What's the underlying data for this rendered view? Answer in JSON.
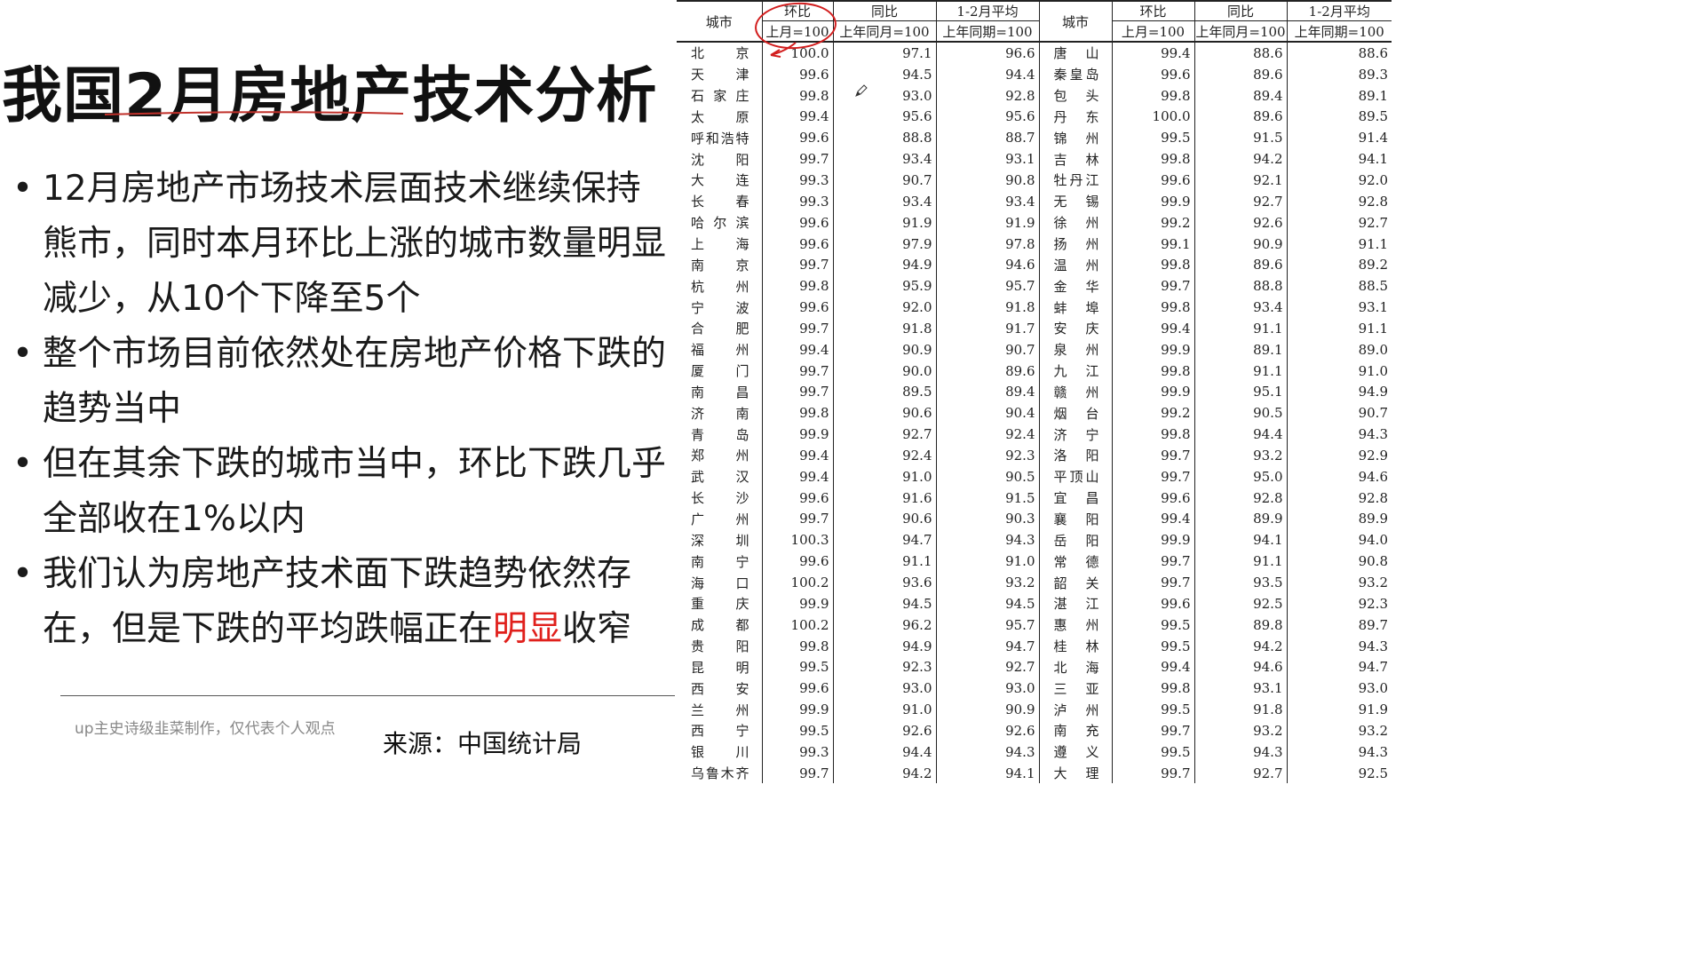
{
  "slide": {
    "title": "我国2月房地产技术分析",
    "bullets": [
      {
        "text": "12月房地产市场技术层面技术继续保持熊市，同时本月环比上涨的城市数量明显减少，从10个下降至5个"
      },
      {
        "text": "整个市场目前依然处在房地产价格下跌的趋势当中"
      },
      {
        "text": "但在其余下跌的城市当中，环比下跌几乎全部收在1%以内"
      },
      {
        "text_before": "我们认为房地产技术面下跌趋势依然存在，但是下跌的平均跌幅正在",
        "highlight": "明显",
        "text_after": "收窄"
      }
    ],
    "bullet_glyph": "•",
    "footer_note": "up主史诗级韭菜制作，仅代表个人观点",
    "source": "来源：中国统计局",
    "colors": {
      "highlight": "#e0201c",
      "annotation": "#d21d1d"
    }
  },
  "table": {
    "headers": {
      "city": "城市",
      "mom": "环比",
      "mom_base": "上月=100",
      "yoy": "同比",
      "yoy_base": "上年同月=100",
      "avg": "1-2月平均",
      "avg_base": "上年同期=100"
    },
    "rows": [
      {
        "left": [
          "北　京",
          "100.0",
          "97.1",
          "96.6"
        ],
        "right": [
          "唐　山",
          "99.4",
          "88.6",
          "88.6"
        ]
      },
      {
        "left": [
          "天　津",
          "99.6",
          "94.5",
          "94.4"
        ],
        "right": [
          "秦皇岛",
          "99.6",
          "89.6",
          "89.3"
        ]
      },
      {
        "left": [
          "石家庄",
          "99.8",
          "93.0",
          "92.8"
        ],
        "right": [
          "包　头",
          "99.8",
          "89.4",
          "89.1"
        ]
      },
      {
        "left": [
          "太　原",
          "99.4",
          "95.6",
          "95.6"
        ],
        "right": [
          "丹　东",
          "100.0",
          "89.6",
          "89.5"
        ]
      },
      {
        "left": [
          "呼和浩特",
          "99.6",
          "88.8",
          "88.7"
        ],
        "right": [
          "锦　州",
          "99.5",
          "91.5",
          "91.4"
        ]
      },
      {
        "left": [
          "沈　阳",
          "99.7",
          "93.4",
          "93.1"
        ],
        "right": [
          "吉　林",
          "99.8",
          "94.2",
          "94.1"
        ]
      },
      {
        "left": [
          "大　连",
          "99.3",
          "90.7",
          "90.8"
        ],
        "right": [
          "牡丹江",
          "99.6",
          "92.1",
          "92.0"
        ]
      },
      {
        "left": [
          "长　春",
          "99.3",
          "93.4",
          "93.4"
        ],
        "right": [
          "无　锡",
          "99.9",
          "92.7",
          "92.8"
        ]
      },
      {
        "left": [
          "哈尔滨",
          "99.6",
          "91.9",
          "91.9"
        ],
        "right": [
          "徐　州",
          "99.2",
          "92.6",
          "92.7"
        ]
      },
      {
        "left": [
          "上　海",
          "99.6",
          "97.9",
          "97.8"
        ],
        "right": [
          "扬　州",
          "99.1",
          "90.9",
          "91.1"
        ]
      },
      {
        "left": [
          "南　京",
          "99.7",
          "94.9",
          "94.6"
        ],
        "right": [
          "温　州",
          "99.8",
          "89.6",
          "89.2"
        ]
      },
      {
        "left": [
          "杭　州",
          "99.8",
          "95.9",
          "95.7"
        ],
        "right": [
          "金　华",
          "99.7",
          "88.8",
          "88.5"
        ]
      },
      {
        "left": [
          "宁　波",
          "99.6",
          "92.0",
          "91.8"
        ],
        "right": [
          "蚌　埠",
          "99.8",
          "93.4",
          "93.1"
        ]
      },
      {
        "left": [
          "合　肥",
          "99.7",
          "91.8",
          "91.7"
        ],
        "right": [
          "安　庆",
          "99.4",
          "91.1",
          "91.1"
        ]
      },
      {
        "left": [
          "福　州",
          "99.4",
          "90.9",
          "90.7"
        ],
        "right": [
          "泉　州",
          "99.9",
          "89.1",
          "89.0"
        ]
      },
      {
        "left": [
          "厦　门",
          "99.7",
          "90.0",
          "89.6"
        ],
        "right": [
          "九　江",
          "99.8",
          "91.1",
          "91.0"
        ]
      },
      {
        "left": [
          "南　昌",
          "99.7",
          "89.5",
          "89.4"
        ],
        "right": [
          "赣　州",
          "99.9",
          "95.1",
          "94.9"
        ]
      },
      {
        "left": [
          "济　南",
          "99.8",
          "90.6",
          "90.4"
        ],
        "right": [
          "烟　台",
          "99.2",
          "90.5",
          "90.7"
        ]
      },
      {
        "left": [
          "青　岛",
          "99.9",
          "92.7",
          "92.4"
        ],
        "right": [
          "济　宁",
          "99.8",
          "94.4",
          "94.3"
        ]
      },
      {
        "left": [
          "郑　州",
          "99.4",
          "92.4",
          "92.3"
        ],
        "right": [
          "洛　阳",
          "99.7",
          "93.2",
          "92.9"
        ]
      },
      {
        "left": [
          "武　汉",
          "99.4",
          "91.0",
          "90.5"
        ],
        "right": [
          "平顶山",
          "99.7",
          "95.0",
          "94.6"
        ]
      },
      {
        "left": [
          "长　沙",
          "99.6",
          "91.6",
          "91.5"
        ],
        "right": [
          "宜　昌",
          "99.6",
          "92.8",
          "92.8"
        ]
      },
      {
        "left": [
          "广　州",
          "99.7",
          "90.6",
          "90.3"
        ],
        "right": [
          "襄　阳",
          "99.4",
          "89.9",
          "89.9"
        ]
      },
      {
        "left": [
          "深　圳",
          "100.3",
          "94.7",
          "94.3"
        ],
        "right": [
          "岳　阳",
          "99.9",
          "94.1",
          "94.0"
        ]
      },
      {
        "left": [
          "南　宁",
          "99.6",
          "91.1",
          "91.0"
        ],
        "right": [
          "常　德",
          "99.7",
          "91.1",
          "90.8"
        ]
      },
      {
        "left": [
          "海　口",
          "100.2",
          "93.6",
          "93.2"
        ],
        "right": [
          "韶　关",
          "99.7",
          "93.5",
          "93.2"
        ]
      },
      {
        "left": [
          "重　庆",
          "99.9",
          "94.5",
          "94.5"
        ],
        "right": [
          "湛　江",
          "99.6",
          "92.5",
          "92.3"
        ]
      },
      {
        "left": [
          "成　都",
          "100.2",
          "96.2",
          "95.7"
        ],
        "right": [
          "惠　州",
          "99.5",
          "89.8",
          "89.7"
        ]
      },
      {
        "left": [
          "贵　阳",
          "99.8",
          "94.9",
          "94.7"
        ],
        "right": [
          "桂　林",
          "99.5",
          "94.2",
          "94.3"
        ]
      },
      {
        "left": [
          "昆　明",
          "99.5",
          "92.3",
          "92.7"
        ],
        "right": [
          "北　海",
          "99.4",
          "94.6",
          "94.7"
        ]
      },
      {
        "left": [
          "西　安",
          "99.6",
          "93.0",
          "93.0"
        ],
        "right": [
          "三　亚",
          "99.8",
          "93.1",
          "93.0"
        ]
      },
      {
        "left": [
          "兰　州",
          "99.9",
          "91.0",
          "90.9"
        ],
        "right": [
          "泸　州",
          "99.5",
          "91.8",
          "91.9"
        ]
      },
      {
        "left": [
          "西　宁",
          "99.5",
          "92.6",
          "92.6"
        ],
        "right": [
          "南　充",
          "99.7",
          "93.2",
          "93.2"
        ]
      },
      {
        "left": [
          "银　川",
          "99.3",
          "94.4",
          "94.3"
        ],
        "right": [
          "遵　义",
          "99.5",
          "94.3",
          "94.3"
        ]
      },
      {
        "left": [
          "乌鲁木齐",
          "99.7",
          "94.2",
          "94.1"
        ],
        "right": [
          "大　理",
          "99.7",
          "92.7",
          "92.5"
        ]
      }
    ]
  }
}
